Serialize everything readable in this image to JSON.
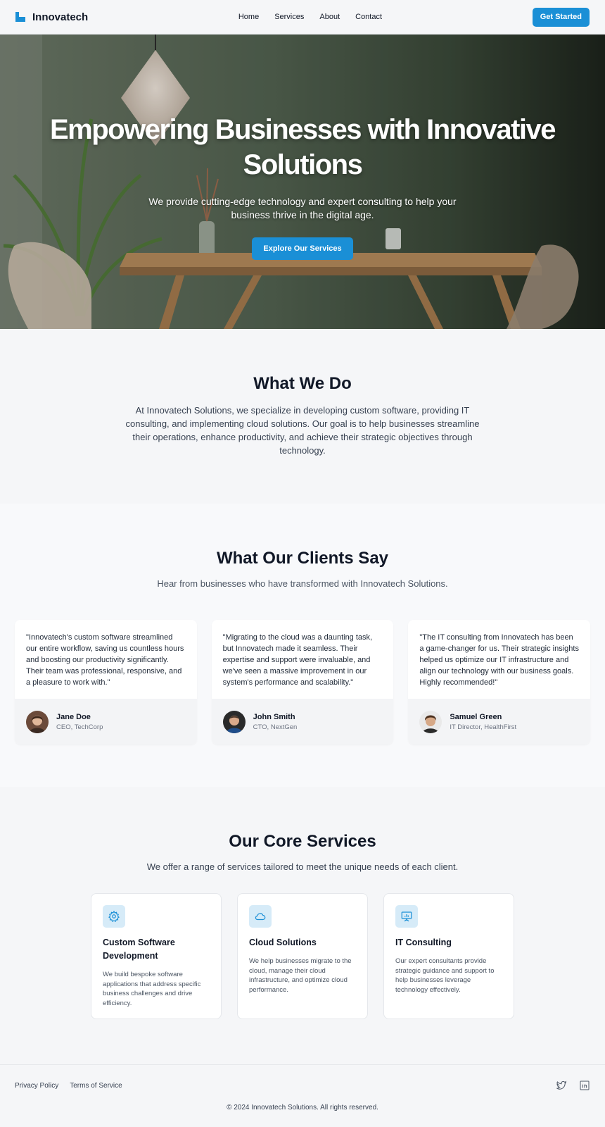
{
  "header": {
    "brand": "Innovatech",
    "nav": [
      "Home",
      "Services",
      "About",
      "Contact"
    ],
    "cta": "Get Started"
  },
  "hero": {
    "title": "Empowering Businesses with Innovative Solutions",
    "subtitle": "We provide cutting-edge technology and expert consulting to help your business thrive in the digital age.",
    "cta": "Explore Our Services"
  },
  "what_we_do": {
    "title": "What We Do",
    "body": "At Innovatech Solutions, we specialize in developing custom software, providing IT consulting, and implementing cloud solutions. Our goal is to help businesses streamline their operations, enhance productivity, and achieve their strategic objectives through technology."
  },
  "testimonials": {
    "title": "What Our Clients Say",
    "subtitle": "Hear from businesses who have transformed with Innovatech Solutions.",
    "items": [
      {
        "quote": "\"Innovatech's custom software streamlined our entire workflow, saving us countless hours and boosting our productivity significantly. Their team was professional, responsive, and a pleasure to work with.\"",
        "name": "Jane Doe",
        "role": "CEO, TechCorp"
      },
      {
        "quote": "\"Migrating to the cloud was a daunting task, but Innovatech made it seamless. Their expertise and support were invaluable, and we've seen a massive improvement in our system's performance and scalability.\"",
        "name": "John Smith",
        "role": "CTO, NextGen"
      },
      {
        "quote": "\"The IT consulting from Innovatech has been a game-changer for us. Their strategic insights helped us optimize our IT infrastructure and align our technology with our business goals. Highly recommended!\"",
        "name": "Samuel Green",
        "role": "IT Director, HealthFirst"
      }
    ]
  },
  "services": {
    "title": "Our Core Services",
    "subtitle": "We offer a range of services tailored to meet the unique needs of each client.",
    "items": [
      {
        "icon": "gear-icon",
        "title": "Custom Software Development",
        "desc": "We build bespoke software applications that address specific business challenges and drive efficiency."
      },
      {
        "icon": "cloud-icon",
        "title": "Cloud Solutions",
        "desc": "We help businesses migrate to the cloud, manage their cloud infrastructure, and optimize cloud performance."
      },
      {
        "icon": "presentation-chart-icon",
        "title": "IT Consulting",
        "desc": "Our expert consultants provide strategic guidance and support to help businesses leverage technology effectively."
      }
    ]
  },
  "footer": {
    "links": [
      "Privacy Policy",
      "Terms of Service"
    ],
    "socials": [
      "twitter-icon",
      "linkedin-icon"
    ],
    "copyright": "© 2024 Innovatech Solutions. All rights reserved."
  },
  "colors": {
    "accent": "#1a8fd6",
    "icon_bg": "#d6ebf8"
  }
}
